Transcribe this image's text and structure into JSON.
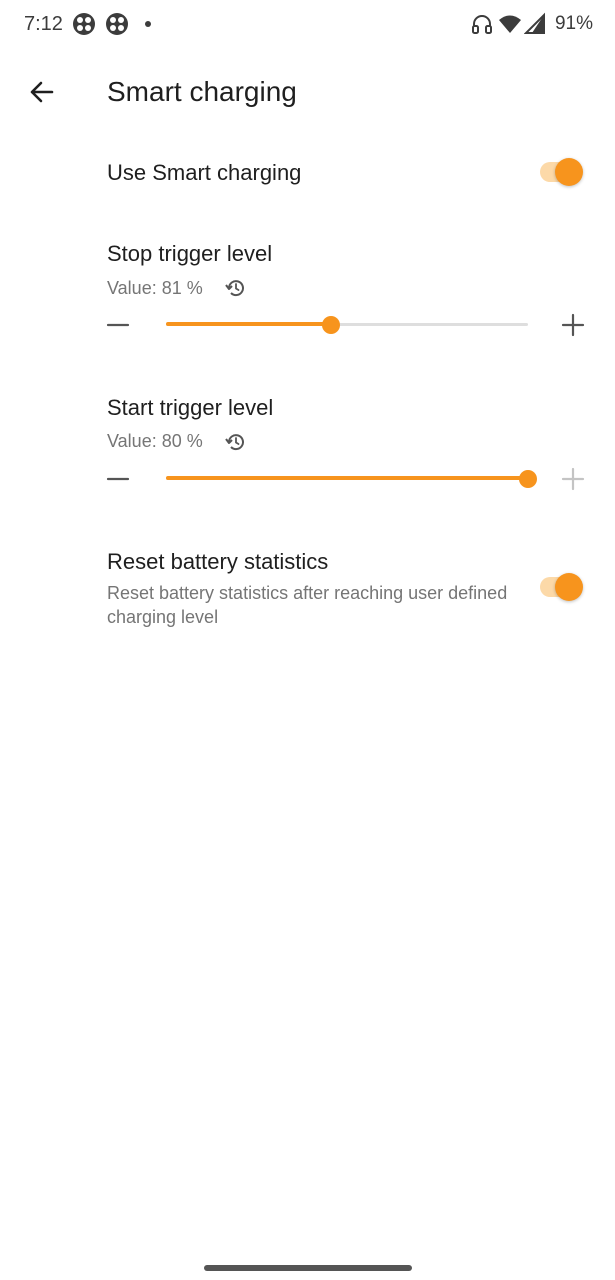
{
  "status_bar": {
    "time": "7:12",
    "battery": "91%",
    "icons": [
      "grid-app-icon",
      "grid-app-icon",
      "notification-dot-icon",
      "headphones-icon",
      "wifi-icon",
      "cell-signal-icon"
    ]
  },
  "app_bar": {
    "title": "Smart charging",
    "back_icon": "arrow-back-icon"
  },
  "settings": {
    "use_smart_charging": {
      "label": "Use Smart charging",
      "enabled": true
    },
    "stop_trigger": {
      "label": "Stop trigger level",
      "value_text": "Value: 81 %",
      "value": 81,
      "slider_fraction": 0.455,
      "minus_enabled": true,
      "plus_enabled": true
    },
    "start_trigger": {
      "label": "Start trigger level",
      "value_text": "Value: 80 %",
      "value": 80,
      "slider_fraction": 1.0,
      "minus_enabled": true,
      "plus_enabled": false
    },
    "reset_battery_stats": {
      "label": "Reset battery statistics",
      "description": "Reset battery statistics after reaching user defined charging level",
      "enabled": true
    }
  },
  "colors": {
    "accent": "#f7941d",
    "accent_track": "#fcd9a8",
    "text_primary": "#1f1f1f",
    "text_secondary": "#757575",
    "disabled": "#bdbdbd"
  }
}
